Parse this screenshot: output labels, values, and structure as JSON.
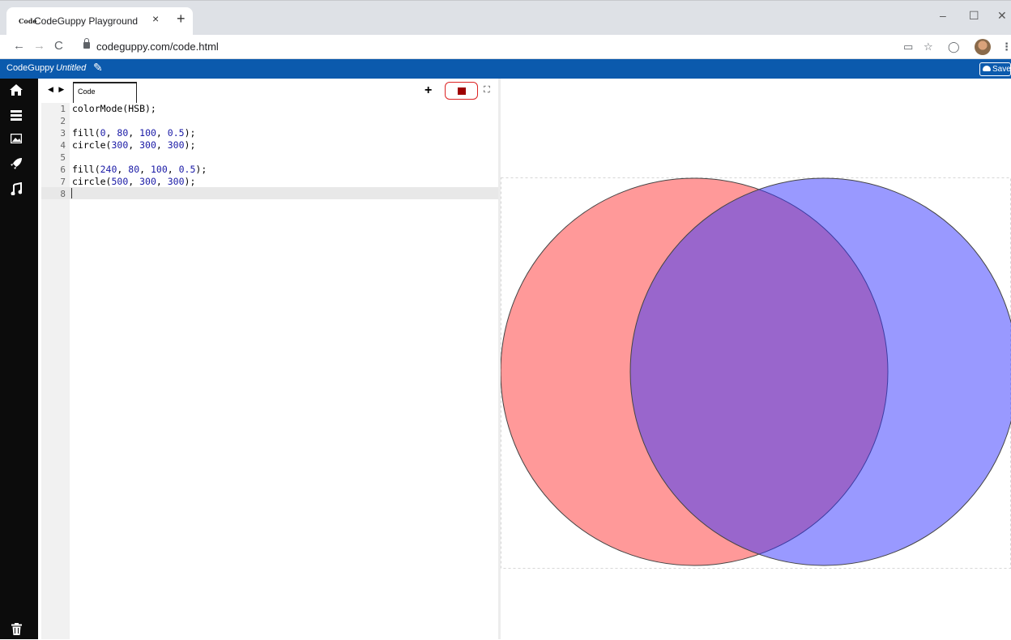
{
  "browser": {
    "favicon": "Code",
    "tab_title": "CodeGuppy Playground",
    "url": "codeguppy.com/code.html",
    "close": "×",
    "new_tab": "+",
    "minimize": "–",
    "maximize": "☐",
    "close_window": "✕"
  },
  "app": {
    "brand": "CodeGuppy",
    "doc_title": "Untitled",
    "save_label": "Save"
  },
  "editor": {
    "tab_label": "Code",
    "arrows": "◀ ▶",
    "add": "+",
    "line_numbers": [
      "1",
      "2",
      "3",
      "4",
      "5",
      "6",
      "7",
      "8"
    ],
    "lines": [
      {
        "text": "colorMode(HSB);",
        "parts": [
          [
            "colorMode(HSB);",
            ""
          ]
        ]
      },
      {
        "text": "",
        "parts": []
      },
      {
        "text": "fill(0, 80, 100, 0.5);",
        "parts": [
          [
            "fill(",
            ""
          ],
          [
            "0",
            "num"
          ],
          [
            ", ",
            ""
          ],
          [
            "80",
            "num"
          ],
          [
            ", ",
            ""
          ],
          [
            "100",
            "num"
          ],
          [
            ", ",
            ""
          ],
          [
            "0.5",
            "num"
          ],
          [
            ");",
            ""
          ]
        ]
      },
      {
        "text": "circle(300, 300, 300);",
        "parts": [
          [
            "circle(",
            ""
          ],
          [
            "300",
            "num"
          ],
          [
            ", ",
            ""
          ],
          [
            "300",
            "num"
          ],
          [
            ", ",
            ""
          ],
          [
            "300",
            "num"
          ],
          [
            ");",
            ""
          ]
        ]
      },
      {
        "text": "",
        "parts": []
      },
      {
        "text": "fill(240, 80, 100, 0.5);",
        "parts": [
          [
            "fill(",
            ""
          ],
          [
            "240",
            "num"
          ],
          [
            ", ",
            ""
          ],
          [
            "80",
            "num"
          ],
          [
            ", ",
            ""
          ],
          [
            "100",
            "num"
          ],
          [
            ", ",
            ""
          ],
          [
            "0.5",
            "num"
          ],
          [
            ");",
            ""
          ]
        ]
      },
      {
        "text": "circle(500, 300, 300);",
        "parts": [
          [
            "circle(",
            ""
          ],
          [
            "500",
            "num"
          ],
          [
            ", ",
            ""
          ],
          [
            "300",
            "num"
          ],
          [
            ", ",
            ""
          ],
          [
            "300",
            "num"
          ],
          [
            ");",
            ""
          ]
        ]
      },
      {
        "text": "",
        "parts": []
      }
    ]
  },
  "sidebar_icons": [
    "home-icon",
    "menu-icon",
    "image-icon",
    "rocket-icon",
    "music-icon",
    "trash-icon"
  ],
  "colors": {
    "appbar": "#0b5aad",
    "sidebar": "#0c0c0c",
    "circle_red": "#ff3333",
    "circle_blue": "#3333ff"
  }
}
